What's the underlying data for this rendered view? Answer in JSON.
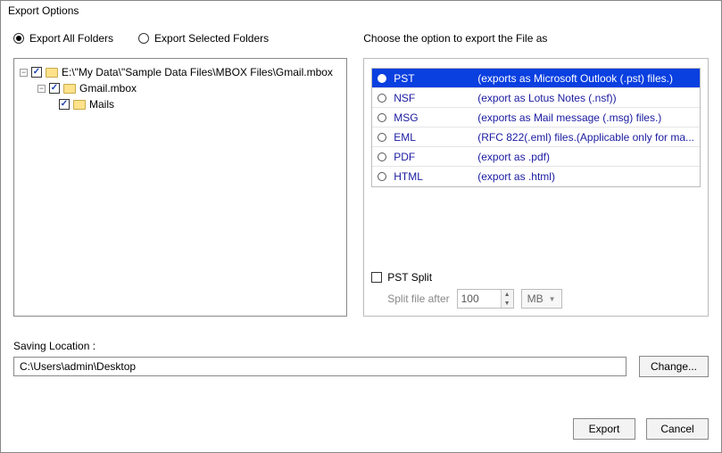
{
  "window": {
    "title": "Export Options"
  },
  "scope": {
    "all_label": "Export All Folders",
    "selected_label": "Export Selected Folders",
    "selected_value": "all"
  },
  "tree": {
    "root": {
      "label": "E:\\\"My Data\\\"Sample Data Files\\MBOX Files\\Gmail.mbox",
      "child": {
        "label": "Gmail.mbox",
        "child": {
          "label": "Mails"
        }
      }
    }
  },
  "format": {
    "header": "Choose the option to export the File as",
    "selected": "PST",
    "items": [
      {
        "name": "PST",
        "desc": "(exports as Microsoft Outlook (.pst) files.)"
      },
      {
        "name": "NSF",
        "desc": "(export as Lotus Notes (.nsf))"
      },
      {
        "name": "MSG",
        "desc": "(exports as Mail message (.msg) files.)"
      },
      {
        "name": "EML",
        "desc": "(RFC 822(.eml) files.(Applicable only for ma..."
      },
      {
        "name": "PDF",
        "desc": "(export as .pdf)"
      },
      {
        "name": "HTML",
        "desc": "(export as .html)"
      }
    ]
  },
  "split": {
    "label": "PST Split",
    "field_label": "Split file after",
    "value": "100",
    "unit": "MB"
  },
  "saving": {
    "label": "Saving Location :",
    "path": "C:\\Users\\admin\\Desktop",
    "change_label": "Change..."
  },
  "buttons": {
    "export": "Export",
    "cancel": "Cancel"
  },
  "glyphs": {
    "minus": "−",
    "up": "▲",
    "down": "▼"
  }
}
